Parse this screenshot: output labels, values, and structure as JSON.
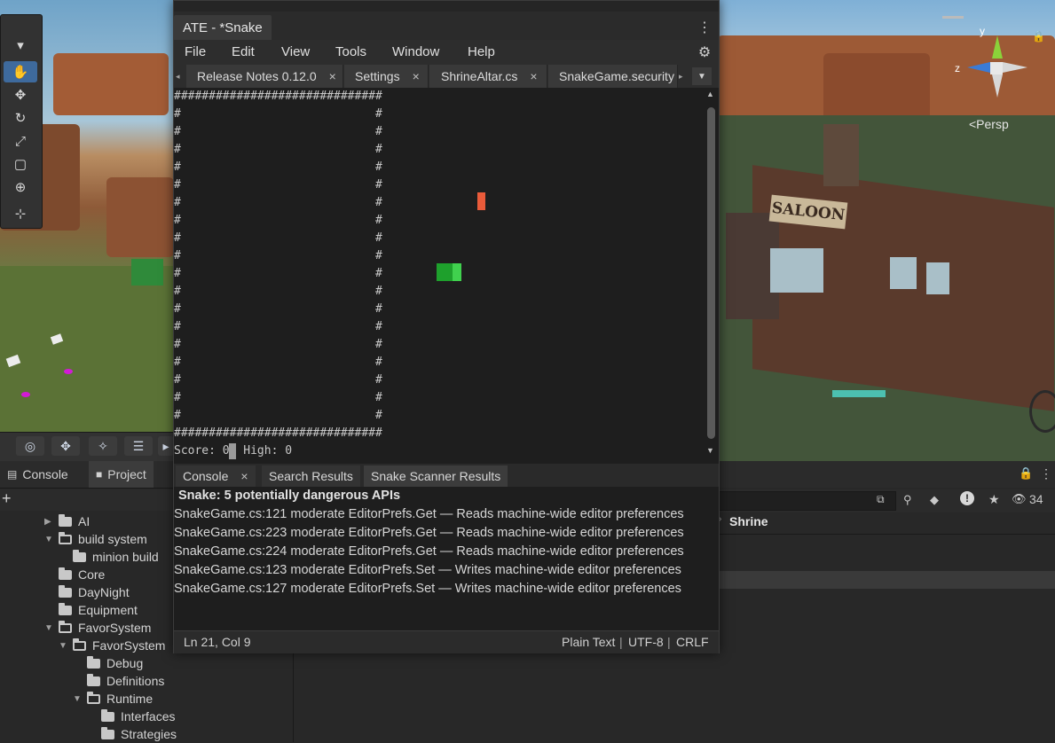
{
  "ate": {
    "window_title": "ATE - *Snake",
    "menu": [
      "File",
      "Edit",
      "View",
      "Tools",
      "Window",
      "Help"
    ],
    "tabs": [
      {
        "label": "Release Notes 0.12.0"
      },
      {
        "label": "Settings"
      },
      {
        "label": "ShrineAltar.cs"
      },
      {
        "label": "SnakeGame.security"
      }
    ],
    "tab_close_glyph": "×",
    "editor_lines": {
      "border_top": "##############################",
      "border_side": "#                            #",
      "border_bottom": "##############################"
    },
    "score_text": "Score: 0",
    "high_text": "  High: 0",
    "output_tabs": [
      "Console",
      "Search Results",
      "Snake Scanner Results"
    ],
    "scanner": {
      "heading": "Snake: 5 potentially dangerous APIs",
      "lines": [
        "SnakeGame.cs:121 moderate EditorPrefs.Get — Reads machine-wide editor preferences",
        "SnakeGame.cs:223 moderate EditorPrefs.Get — Reads machine-wide editor preferences",
        "SnakeGame.cs:224 moderate EditorPrefs.Get — Reads machine-wide editor preferences",
        "SnakeGame.cs:123 moderate EditorPrefs.Set — Writes machine-wide editor preferences",
        "SnakeGame.cs:127 moderate EditorPrefs.Set — Writes machine-wide editor preferences"
      ]
    },
    "status": {
      "position": "Ln 21, Col 9",
      "mode": "Plain Text",
      "encoding": "UTF-8",
      "line_endings": "CRLF",
      "sep": "|"
    },
    "colors": {
      "food": "#ea5b3a",
      "snake_head": "#40d14e",
      "snake_body": "#1ea02c"
    }
  },
  "unity": {
    "bottom_left_tabs": {
      "console": "Console",
      "project": "Project"
    },
    "add_button": "+",
    "project_tree": [
      {
        "label": "AI",
        "depth": 0,
        "open": false,
        "arrow": true
      },
      {
        "label": "build system",
        "depth": 0,
        "open": true,
        "arrow": true
      },
      {
        "label": "minion build",
        "depth": 1,
        "open": false,
        "arrow": false
      },
      {
        "label": "Core",
        "depth": 0,
        "open": false,
        "arrow": false
      },
      {
        "label": "DayNight",
        "depth": 0,
        "open": false,
        "arrow": false
      },
      {
        "label": "Equipment",
        "depth": 0,
        "open": false,
        "arrow": false
      },
      {
        "label": "FavorSystem",
        "depth": 0,
        "open": true,
        "arrow": true
      },
      {
        "label": "FavorSystem",
        "depth": 1,
        "open": true,
        "arrow": true
      },
      {
        "label": "Debug",
        "depth": 2,
        "open": false,
        "arrow": false
      },
      {
        "label": "Definitions",
        "depth": 2,
        "open": false,
        "arrow": false
      },
      {
        "label": "Runtime",
        "depth": 2,
        "open": true,
        "arrow": true
      },
      {
        "label": "Interfaces",
        "depth": 3,
        "open": false,
        "arrow": false
      },
      {
        "label": "Strategies",
        "depth": 3,
        "open": false,
        "arrow": false
      }
    ],
    "inspector_breadcrumb": "Shrine",
    "visibility_count": "34",
    "scene_gizmo": {
      "y": "y",
      "z": "z",
      "persp": "<Persp"
    },
    "saloon_sign": "SALOON",
    "colors": {
      "selected_tool": "#3e6a9d"
    }
  }
}
